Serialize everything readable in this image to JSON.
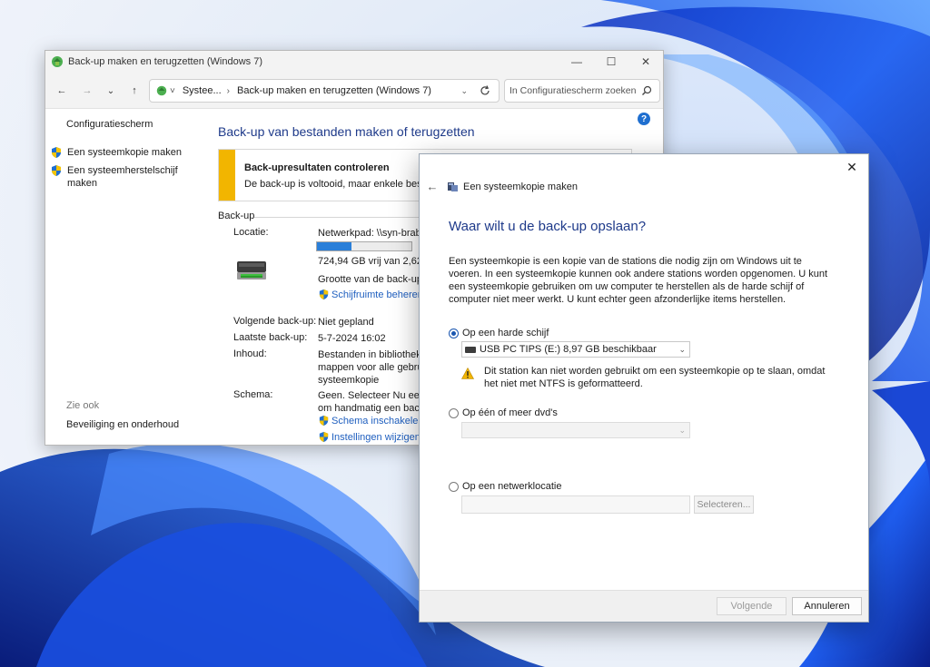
{
  "back_window": {
    "title": "Back-up maken en terugzetten (Windows 7)",
    "breadcrumb": [
      "Systee...",
      "Back-up maken en terugzetten (Windows 7)"
    ],
    "search_placeholder": "In Configuratiescherm zoeken",
    "left_pane": {
      "home": "Configuratiescherm",
      "links": [
        "Een systeemkopie maken",
        "Een systeemherstelschijf maken"
      ],
      "see_also": "Zie ook",
      "security": "Beveiliging en onderhoud"
    },
    "main": {
      "title": "Back-up van bestanden maken of terugzetten",
      "alert_title": "Back-upresultaten controleren",
      "alert_body": "De back-up is voltooid, maar enkele bestan",
      "section": "Back-up",
      "location_label": "Locatie:",
      "location_value": "Netwerkpad: \\\\syn-braba",
      "progress_fraction": 0.37,
      "free_space": "724,94 GB vrij van 2,62 TI",
      "size_label": "Grootte van de back-up:",
      "manage_space": "Schijfruimte beheren",
      "next_label": "Volgende back-up:",
      "next_value": "Niet gepland",
      "last_label": "Laatste back-up:",
      "last_value": "5-7-2024 16:02",
      "contents_label": "Inhoud:",
      "contents_lines": [
        "Bestanden in bibliotheke",
        "mappen voor alle gebrui",
        "systeemkopie"
      ],
      "schedule_label": "Schema:",
      "schedule_lines": [
        "Geen. Selecteer Nu een b",
        "om handmatig een back"
      ],
      "enable_schedule": "Schema inschakelen",
      "change_settings": "Instellingen wijzigen"
    }
  },
  "dialog": {
    "app_title": "Een systeemkopie maken",
    "heading": "Waar wilt u de back-up opslaan?",
    "description": "Een systeemkopie is een kopie van de stations die nodig zijn om Windows uit te voeren. In een systeemkopie kunnen ook andere stations worden opgenomen. U kunt een systeemkopie gebruiken om uw computer te herstellen als de harde schijf of computer niet meer werkt. U kunt echter geen afzonderlijke items herstellen.",
    "option_hdd": "Op een harde schijf",
    "hdd_selected": "USB PC TIPS (E:)  8,97 GB beschikbaar",
    "warning": "Dit station kan niet worden gebruikt om een systeemkopie op te slaan, omdat het niet met NTFS is geformatteerd.",
    "option_dvd": "Op één of meer dvd's",
    "option_network": "Op een netwerklocatie",
    "select_button": "Selecteren...",
    "next_button": "Volgende",
    "cancel_button": "Annuleren"
  },
  "icons": {
    "app": "backup-app-icon",
    "shield": "uac-shield-icon",
    "warning": "warning-icon",
    "drive": "network-drive-icon"
  },
  "colors": {
    "accent_blue": "#1e3a8a",
    "link_blue": "#1f5fbf",
    "warning_yellow": "#f2b500",
    "progress_blue": "#2a7fd9"
  }
}
